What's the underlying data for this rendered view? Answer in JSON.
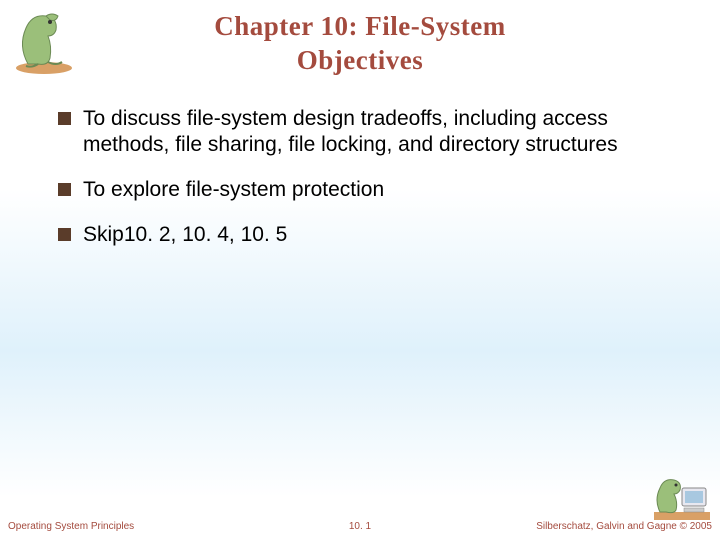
{
  "title": {
    "line1": "Chapter 10:  File-System",
    "line2": "Objectives"
  },
  "bullets": [
    "To discuss file-system design tradeoffs, including access methods, file sharing, file locking, and directory structures",
    "To explore file-system protection",
    " Skip10. 2, 10. 4, 10. 5"
  ],
  "footer": {
    "left": "Operating System Principles",
    "center": "10. 1",
    "right": "Silberschatz, Galvin and Gagne © 2005"
  },
  "colors": {
    "accent": "#a44b3e",
    "bullet": "#5a3c2a"
  }
}
